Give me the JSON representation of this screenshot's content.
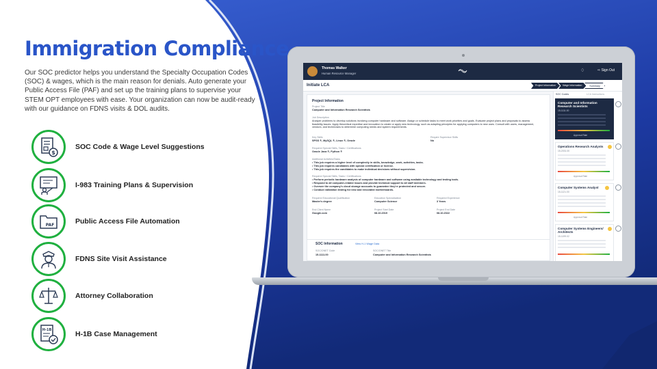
{
  "headline": "Immigration Compliance",
  "intro": "Our SOC predictor helps you understand the Specialty Occupation Codes (SOC) & wages, which is the main reason for denials. Auto generate your Public Access File (PAF) and set up the training plans to supervise your STEM OPT employees with ease. Your organization can now be audit-ready with our guidance on FDNS visits & DOL audits.",
  "features": [
    {
      "label": "SOC Code & Wage Level Suggestions",
      "icon": "soc-document-dollar-icon"
    },
    {
      "label": "I-983 Training Plans & Supervision",
      "icon": "training-presentation-icon"
    },
    {
      "label": "Public Access File Automation",
      "icon": "paf-folder-icon"
    },
    {
      "label": "FDNS Site Visit Assistance",
      "icon": "officer-icon"
    },
    {
      "label": "Attorney Collaboration",
      "icon": "scales-of-justice-icon"
    },
    {
      "label": "H-1B Case Management",
      "icon": "h1b-document-check-icon"
    }
  ],
  "colors": {
    "accent": "#1fb03f",
    "headline": "#2a55c8",
    "navy": "#1d2a43"
  },
  "app": {
    "user_name": "Thomas Walker",
    "user_role": "Human Resource Manager",
    "sign_out": "Sign Out",
    "page_title": "Initiate LCA",
    "steps": [
      "Project Information",
      "Wage Information",
      "Summary"
    ],
    "project": {
      "section": "Project Information",
      "project_title_label": "Project Title",
      "project_title": "Computer and Information Research Scientists",
      "job_desc_label": "Job Description",
      "job_desc": "Analyze problems to develop solutions involving computer hardware and software. Assign or schedule tasks to meet work priorities and goals. Evaluate project plans and proposals to assess feasibility issues. Apply theoretical expertise and innovation to create or apply new technology, such as adapting principles for applying computers to new uses. Consult with users, management, vendors, and technicians to determine computing needs and system requirements.",
      "key_skills_label": "Key Skills",
      "key_skills": "SPSS ®, MySQL ®, Linux ®, Oracle",
      "supervisor_label": "Require Supervisor Skills",
      "supervisor": "No",
      "special_label": "Required Special Skills, Tasks / Certifications",
      "special": "Oracle Java ®, Python ®",
      "additional_label": "Additional Activities/Tasks",
      "additional": [
        "This job requires a higher level of complexity in skills, knowledge, work, activities, tasks.",
        "This job requires candidates with special certification or license.",
        "This job requires the candidates to make individual decisions without supervision."
      ],
      "req_special_label": "Required Special Skills, Tasks / Certifications",
      "req_special": [
        "Perform periodic hardware analysis of computer hardware and software using available technology and testing tools.",
        "Respond to all computer-related issues and provide technical support to all staff members.",
        "Oversee the company's cloud storage accounts to guarantee they're protected and secure.",
        "Conduct validation testing for new and renovated motherboards."
      ],
      "edu_label": "Required Educational Qualification",
      "edu": "Master's degree",
      "spec_label": "Education Specialization",
      "spec": "Computer Science",
      "exp_label": "Required Experience",
      "exp": "3 Years",
      "client_label": "End Client Name",
      "client": "Google.com",
      "start_label": "Project Start Date",
      "start": "08.10.2019",
      "end_label": "Project End Date",
      "end": "08.10.2022"
    },
    "soc_info": {
      "section": "SOC Information",
      "link": "View H-1 Wage Data",
      "code_label": "SOC/ONET Code",
      "code": "15-1111.00",
      "title_label": "SOC/ONET Title",
      "title": "Computer and Information Research Scientists"
    },
    "side_tabs": [
      "SOC Codes",
      "LCA Instructions"
    ],
    "soc_cards": [
      {
        "title": "Computer and Information Research Scientists",
        "code": "15-1111.00",
        "approval": "Approval Rate",
        "selected": true
      },
      {
        "title": "Operations Research Analysts",
        "code": "15-2031.00",
        "approval": "Approval Rate",
        "selected": false
      },
      {
        "title": "Computer Systems Analyst",
        "code": "15-1121.00",
        "approval": "Approval Rate",
        "selected": false
      },
      {
        "title": "Computer Systems Engineers/ Architects",
        "code": "15-1199.02",
        "approval": "",
        "selected": false
      }
    ]
  }
}
